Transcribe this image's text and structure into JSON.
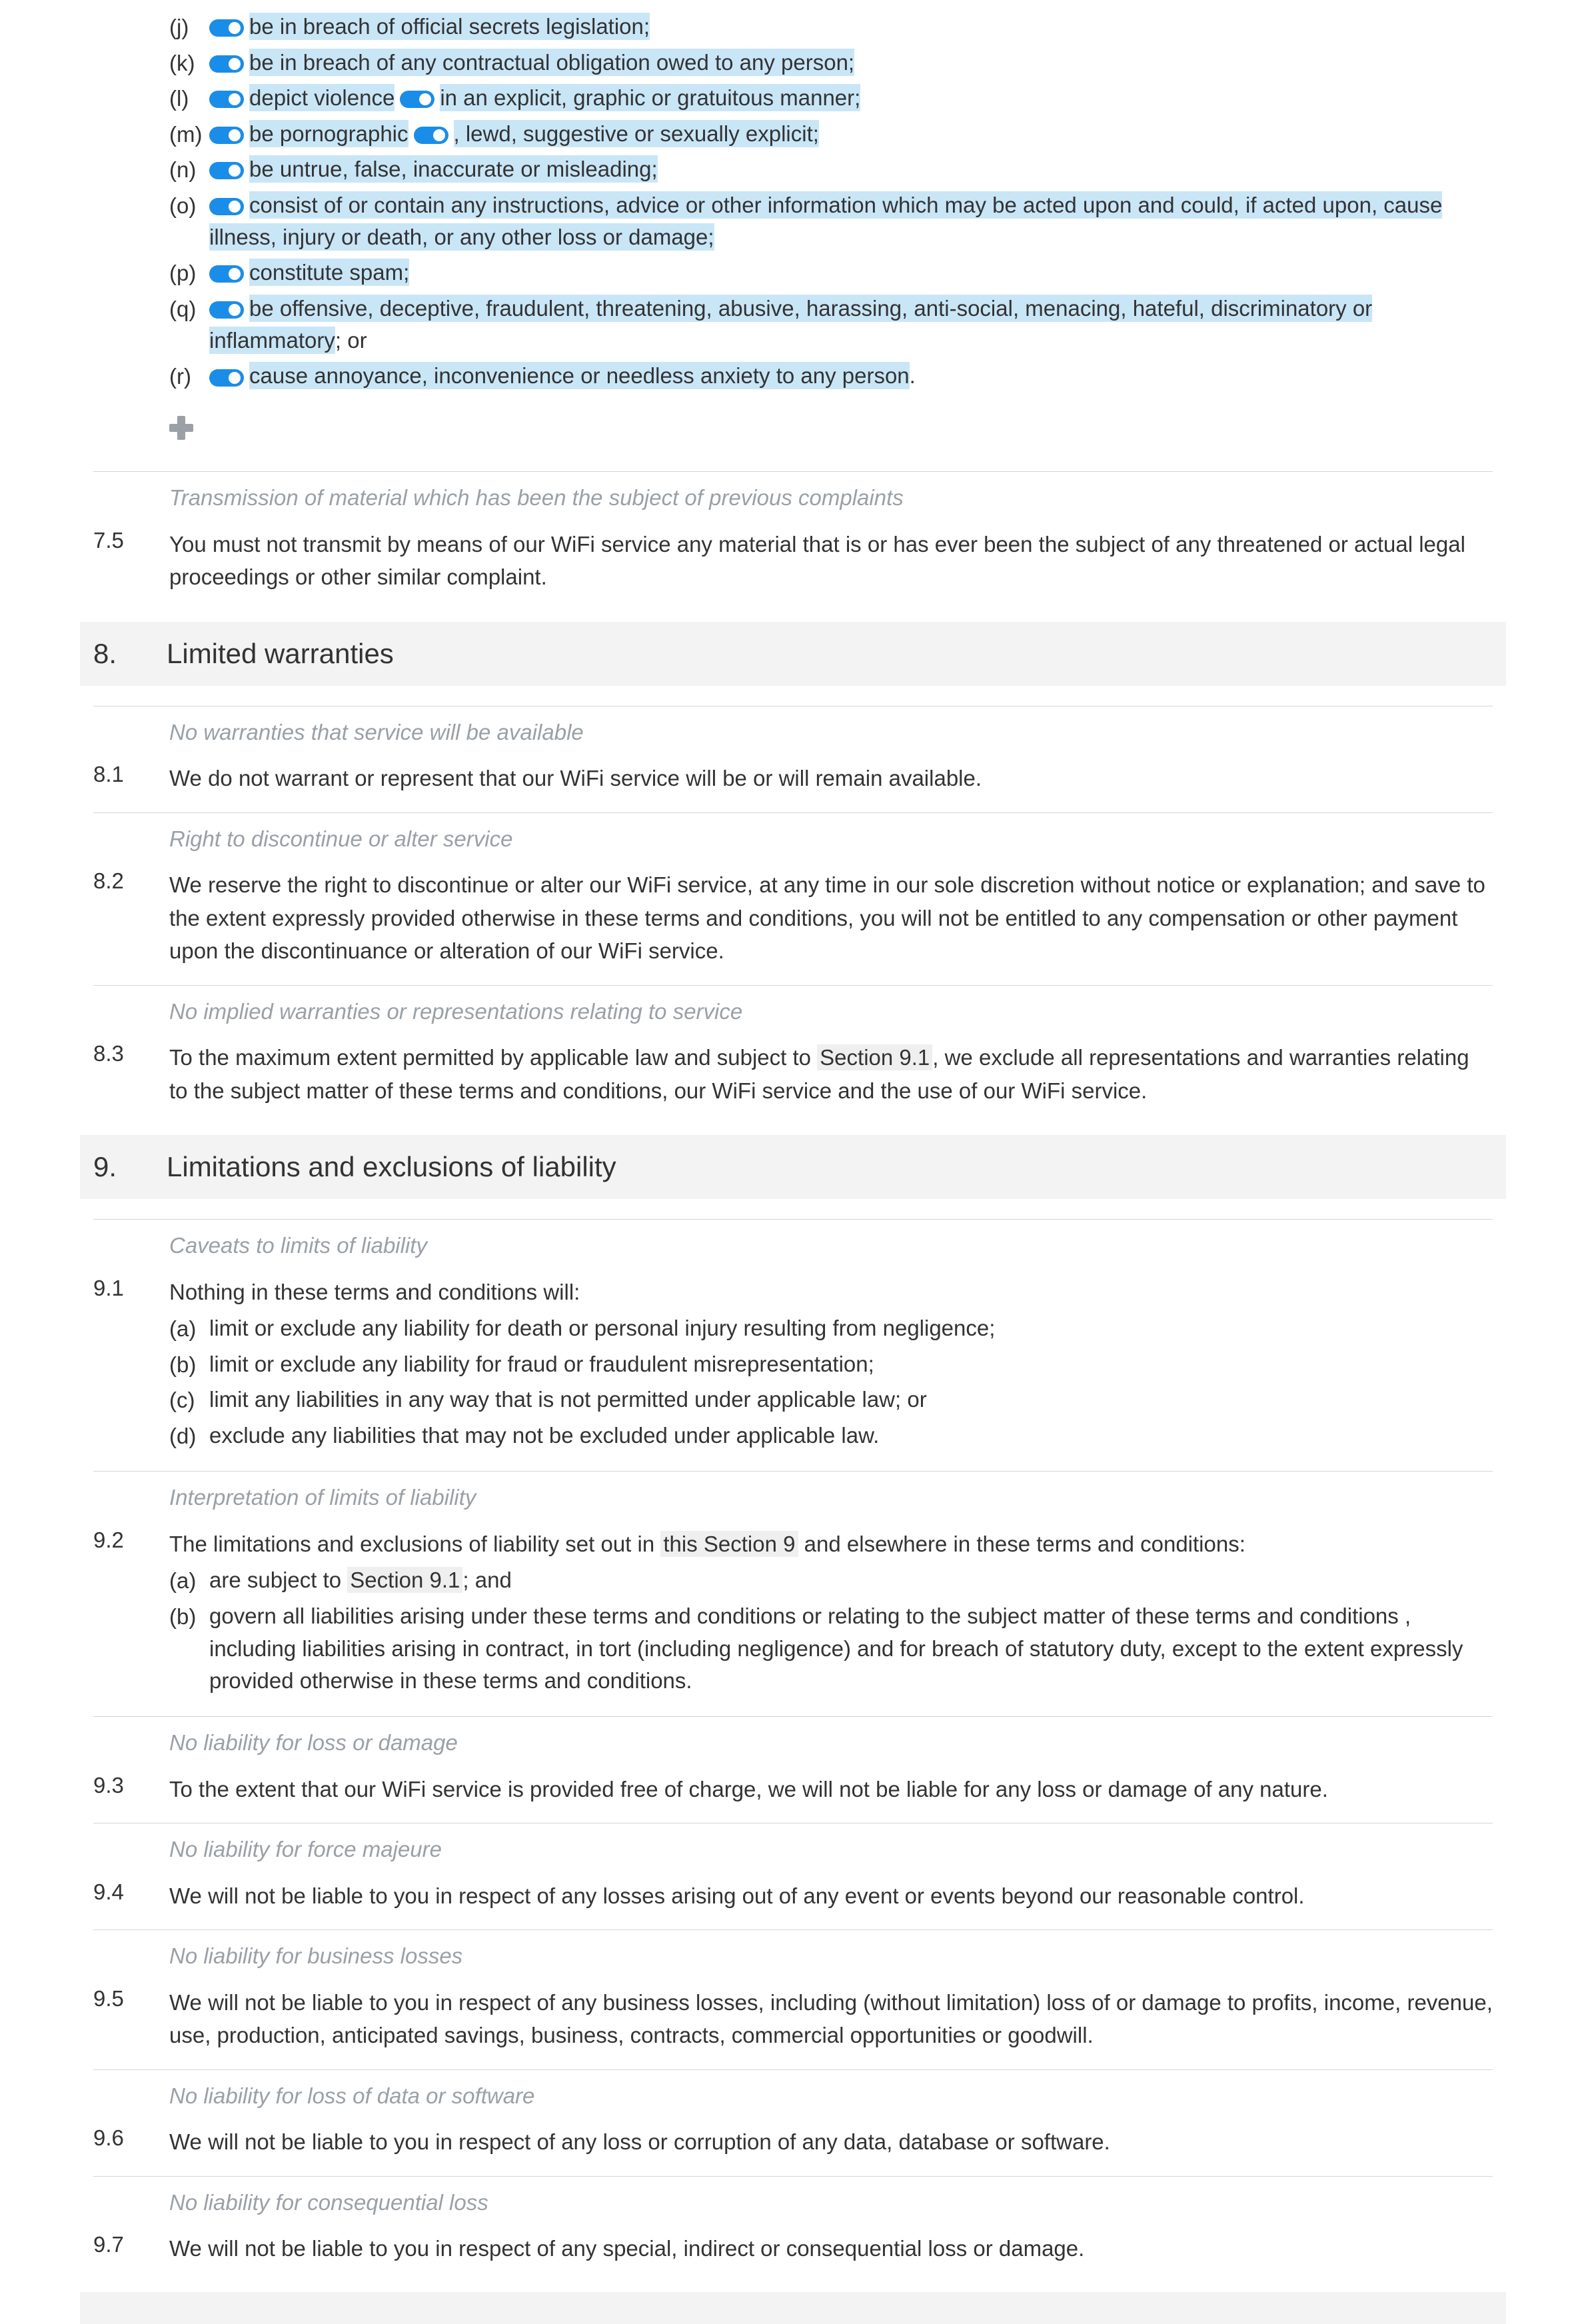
{
  "items74": [
    {
      "letter": "(j)",
      "text": "be in breach of official secrets legislation;",
      "hl": true
    },
    {
      "letter": "(k)",
      "text": "be in breach of any contractual obligation owed to any person;",
      "hl": true
    },
    {
      "letter": "(l)",
      "pre": "depict violence",
      "post": "in an explicit, graphic or gratuitous manner;",
      "split": true
    },
    {
      "letter": "(m)",
      "pre": "be pornographic",
      "post": ", lewd, suggestive or sexually explicit;",
      "split": true
    },
    {
      "letter": "(n)",
      "text": "be untrue, false, inaccurate or misleading;",
      "hl": true
    },
    {
      "letter": "(o)",
      "text": "consist of or contain any instructions, advice or other information which may be acted upon and could, if acted upon, cause illness, injury or death, or any other loss or damage;",
      "hl": true
    },
    {
      "letter": "(p)",
      "text": "constitute spam;",
      "hl": true
    },
    {
      "letter": "(q)",
      "text": "be offensive, deceptive, fraudulent, threatening, abusive, harassing, anti-social, menacing, hateful, discriminatory or inflammatory",
      "suffix": "; or",
      "hl": true
    },
    {
      "letter": "(r)",
      "text": "cause annoyance, inconvenience or needless anxiety to any person",
      "suffix": ".",
      "hl": true
    }
  ],
  "cap75": "Transmission of material which has been the subject of previous complaints",
  "c75": {
    "num": "7.5",
    "text": "You must not transmit by means of our WiFi service any material that is or has ever been the subject of any threatened or actual legal proceedings or other similar complaint."
  },
  "sec8": {
    "num": "8.",
    "title": "Limited warranties"
  },
  "cap81": "No warranties that service will be available",
  "c81": {
    "num": "8.1",
    "text": "We do not warrant or represent that our WiFi service will be or will remain available."
  },
  "cap82": "Right to discontinue or alter service",
  "c82": {
    "num": "8.2",
    "text": "We reserve the right to discontinue or alter our WiFi service, at any time in our sole discretion without notice or explanation; and save to the extent expressly provided otherwise in these terms and conditions, you will not be entitled to any compensation or other payment upon the discontinuance or alteration of our WiFi service."
  },
  "cap83": "No implied warranties or representations relating to service",
  "c83": {
    "num": "8.3",
    "pre": "To the maximum extent permitted by applicable law and subject to ",
    "ref": "Section 9.1",
    "post": ", we exclude all representations and warranties relating to the subject matter of these terms and conditions, our WiFi service and the use of our WiFi service."
  },
  "sec9": {
    "num": "9.",
    "title": "Limitations and exclusions of liability"
  },
  "cap91": "Caveats to limits of liability",
  "c91": {
    "num": "9.1",
    "intro": "Nothing in these terms and conditions will:",
    "subs": [
      {
        "l": "(a)",
        "t": "limit or exclude any liability for death or personal injury resulting from negligence;"
      },
      {
        "l": "(b)",
        "t": "limit or exclude any liability for fraud or fraudulent misrepresentation;"
      },
      {
        "l": "(c)",
        "t": "limit any liabilities in any way that is not permitted under applicable law; or"
      },
      {
        "l": "(d)",
        "t": "exclude any liabilities that may not be excluded under applicable law."
      }
    ]
  },
  "cap92": "Interpretation of limits of liability",
  "c92": {
    "num": "9.2",
    "pre": "The limitations and exclusions of liability set out in ",
    "ref": "this Section 9",
    "post": " and elsewhere in these terms and conditions:",
    "suba_pre": "are subject to ",
    "suba_ref": "Section 9.1",
    "suba_post": "; and",
    "subb": "govern all liabilities arising under these terms and conditions or relating to the subject matter of these terms and conditions , including liabilities arising in contract, in tort (including negligence) and for breach of statutory duty, except to the extent expressly provided otherwise in these terms and conditions."
  },
  "cap93": "No liability for loss or damage",
  "c93": {
    "num": "9.3",
    "text": "To the extent that our WiFi service is provided free of charge, we will not be liable for any loss or damage of any nature."
  },
  "cap94": "No liability for force majeure",
  "c94": {
    "num": "9.4",
    "text": "We will not be liable to you in respect of any losses arising out of any event or events beyond our reasonable control."
  },
  "cap95": "No liability for business losses",
  "c95": {
    "num": "9.5",
    "text": "We will not be liable to you in respect of any business losses, including (without limitation) loss of or damage to profits, income, revenue, use, production, anticipated savings, business, contracts, commercial opportunities or goodwill."
  },
  "cap96": "No liability for loss of data or software",
  "c96": {
    "num": "9.6",
    "text": "We will not be liable to you in respect of any loss or corruption of any data, database or software."
  },
  "cap97": "No liability for consequential loss",
  "c97": {
    "num": "9.7",
    "text": "We will not be liable to you in respect of any special, indirect or consequential loss or damage."
  },
  "letters": {
    "a": "(a)",
    "b": "(b)"
  }
}
